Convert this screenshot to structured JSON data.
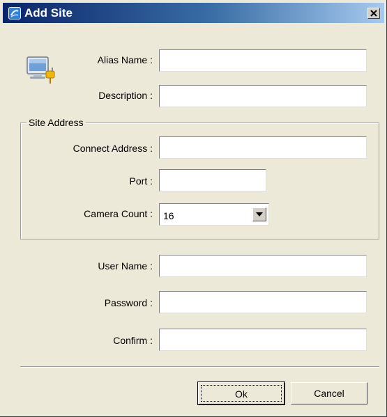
{
  "window": {
    "title": "Add Site",
    "icon": "app-icon",
    "close_icon": "close-icon"
  },
  "form": {
    "site_icon": "computer-plug-icon",
    "alias_name": {
      "label": "Alias Name :",
      "value": ""
    },
    "description": {
      "label": "Description :",
      "value": ""
    },
    "site_address": {
      "legend": "Site Address",
      "connect_address": {
        "label": "Connect Address :",
        "value": ""
      },
      "port": {
        "label": "Port :",
        "value": ""
      },
      "camera_count": {
        "label": "Camera Count :",
        "value": "16"
      }
    },
    "user_name": {
      "label": "User Name :",
      "value": ""
    },
    "password": {
      "label": "Password :",
      "value": ""
    },
    "confirm": {
      "label": "Confirm :",
      "value": ""
    }
  },
  "buttons": {
    "ok": "Ok",
    "cancel": "Cancel"
  }
}
